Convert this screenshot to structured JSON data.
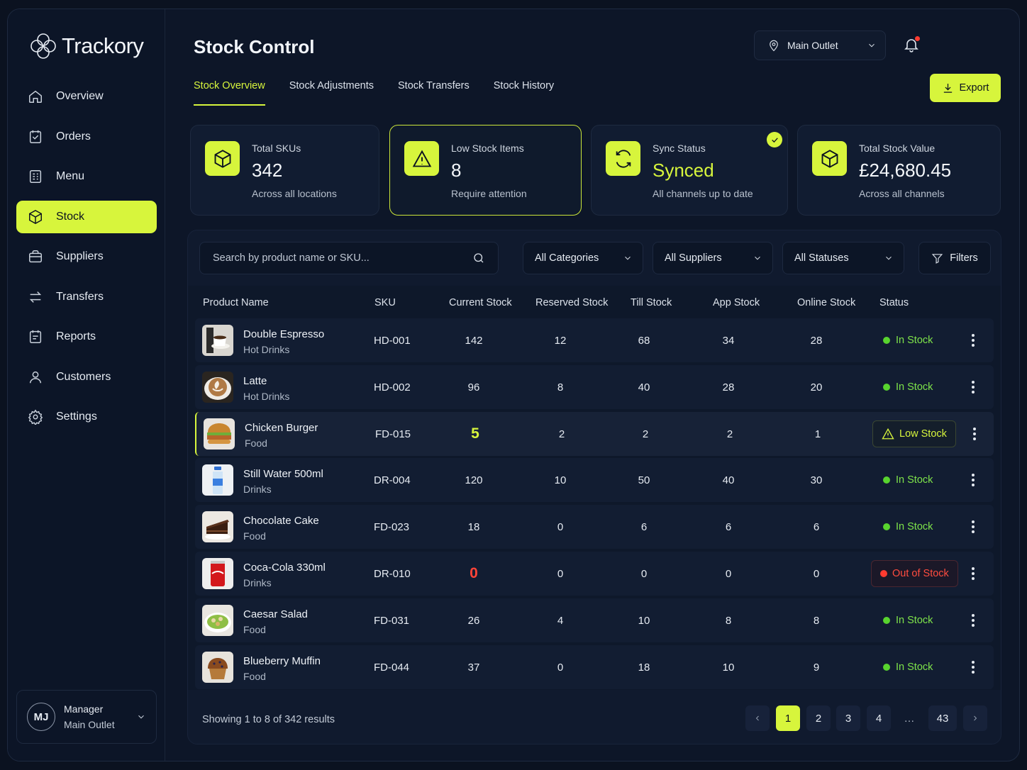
{
  "app": {
    "brand": "Trackory"
  },
  "sidebar": {
    "items": [
      {
        "label": "Overview",
        "icon": "home-icon"
      },
      {
        "label": "Orders",
        "icon": "orders-icon"
      },
      {
        "label": "Menu",
        "icon": "menu-icon"
      },
      {
        "label": "Stock",
        "icon": "box-icon",
        "active": true
      },
      {
        "label": "Suppliers",
        "icon": "suppliers-icon"
      },
      {
        "label": "Transfers",
        "icon": "transfer-icon"
      },
      {
        "label": "Reports",
        "icon": "reports-icon"
      },
      {
        "label": "Customers",
        "icon": "user-icon"
      },
      {
        "label": "Settings",
        "icon": "gear-icon"
      }
    ],
    "user": {
      "initials": "MJ",
      "role": "Manager",
      "location": "Main Outlet"
    }
  },
  "header": {
    "title": "Stock Control",
    "outlet": "Main Outlet",
    "export_label": "Export",
    "tabs": [
      "Stock Overview",
      "Stock Adjustments",
      "Stock Transfers",
      "Stock History"
    ],
    "active_tab": 0
  },
  "stats": [
    {
      "label": "Total SKUs",
      "value": "342",
      "sub": "Across all locations",
      "icon": "box-icon"
    },
    {
      "label": "Low Stock Items",
      "value": "8",
      "sub": "Require attention",
      "icon": "warning-icon"
    },
    {
      "label": "Sync Status",
      "value": "Synced",
      "sub": "All channels up to date",
      "icon": "sync-icon"
    },
    {
      "label": "Total Stock Value",
      "value": "£24,680.45",
      "sub": "Across all channels",
      "icon": "box-icon"
    }
  ],
  "filters": {
    "search_placeholder": "Search by product name or SKU...",
    "categories": "All Categories",
    "suppliers": "All Suppliers",
    "statuses": "All Statuses",
    "filters_label": "Filters"
  },
  "table": {
    "columns": [
      "Product Name",
      "SKU",
      "Current Stock",
      "Reserved Stock",
      "Till Stock",
      "App Stock",
      "Online Stock",
      "Status"
    ],
    "rows": [
      {
        "name": "Double Espresso",
        "category": "Hot Drinks",
        "sku": "HD-001",
        "current": "142",
        "reserved": "12",
        "till": "68",
        "app": "34",
        "online": "28",
        "status": "In Stock",
        "thumb": "espresso"
      },
      {
        "name": "Latte",
        "category": "Hot Drinks",
        "sku": "HD-002",
        "current": "96",
        "reserved": "8",
        "till": "40",
        "app": "28",
        "online": "20",
        "status": "In Stock",
        "thumb": "latte"
      },
      {
        "name": "Chicken Burger",
        "category": "Food",
        "sku": "FD-015",
        "current": "5",
        "reserved": "2",
        "till": "2",
        "app": "2",
        "online": "1",
        "status": "Low Stock",
        "thumb": "burger"
      },
      {
        "name": "Still Water 500ml",
        "category": "Drinks",
        "sku": "DR-004",
        "current": "120",
        "reserved": "10",
        "till": "50",
        "app": "40",
        "online": "30",
        "status": "In Stock",
        "thumb": "water"
      },
      {
        "name": "Chocolate Cake",
        "category": "Food",
        "sku": "FD-023",
        "current": "18",
        "reserved": "0",
        "till": "6",
        "app": "6",
        "online": "6",
        "status": "In Stock",
        "thumb": "cake"
      },
      {
        "name": "Coca-Cola 330ml",
        "category": "Drinks",
        "sku": "DR-010",
        "current": "0",
        "reserved": "0",
        "till": "0",
        "app": "0",
        "online": "0",
        "status": "Out of Stock",
        "thumb": "cola"
      },
      {
        "name": "Caesar Salad",
        "category": "Food",
        "sku": "FD-031",
        "current": "26",
        "reserved": "4",
        "till": "10",
        "app": "8",
        "online": "8",
        "status": "In Stock",
        "thumb": "salad"
      },
      {
        "name": "Blueberry Muffin",
        "category": "Food",
        "sku": "FD-044",
        "current": "37",
        "reserved": "0",
        "till": "18",
        "app": "10",
        "online": "9",
        "status": "In Stock",
        "thumb": "muffin"
      }
    ]
  },
  "pagination": {
    "summary": "Showing 1 to 8 of 342 results",
    "pages": [
      "1",
      "2",
      "3",
      "4",
      "…",
      "43"
    ],
    "current": "1"
  },
  "colors": {
    "accent": "#d7f53c",
    "in_stock": "#58d42e",
    "out_of_stock": "#ff3b30",
    "background": "#0d1628"
  }
}
